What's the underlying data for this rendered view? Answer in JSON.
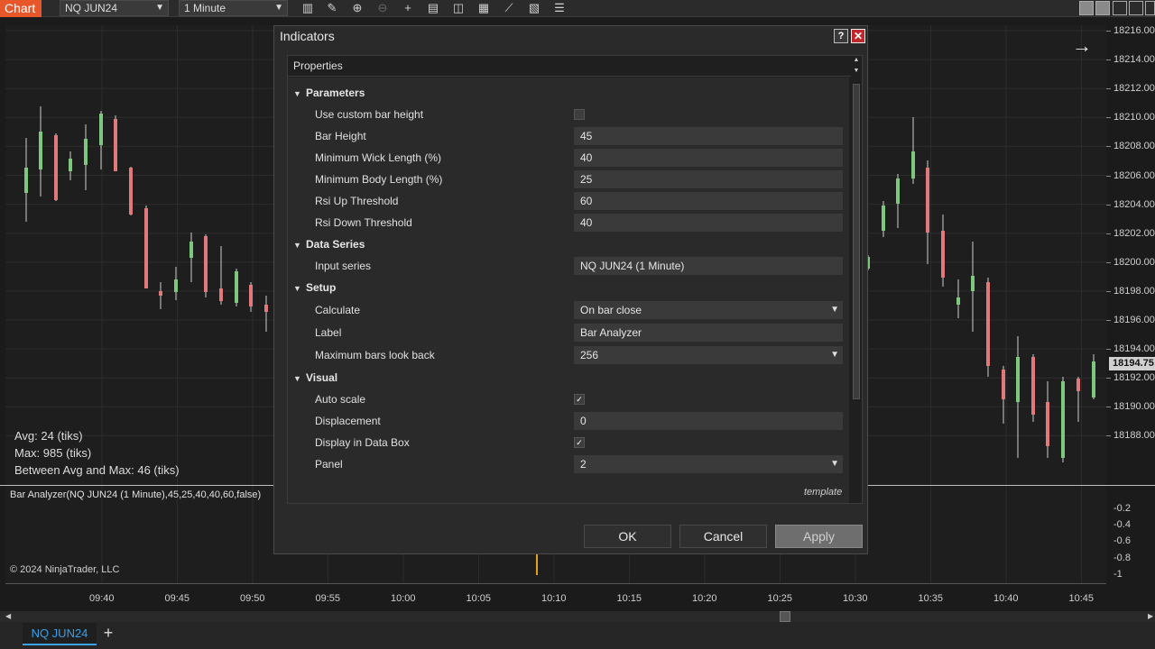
{
  "toolbar": {
    "chart_tab": "Chart",
    "instrument": "NQ JUN24",
    "interval": "1 Minute",
    "icons": [
      "bar-type-icon",
      "draw-pencil-icon",
      "zoom-in-icon",
      "zoom-out-icon",
      "crosshair-icon",
      "data-box-icon",
      "properties-icon",
      "indicators-icon",
      "strategies-icon",
      "templates-icon",
      "menu-icon"
    ]
  },
  "price_axis": {
    "ticks": [
      "18216.00",
      "18214.00",
      "18212.00",
      "18210.00",
      "18208.00",
      "18206.00",
      "18204.00",
      "18202.00",
      "18200.00",
      "18198.00",
      "18196.00",
      "18194.00",
      "18192.00",
      "18190.00",
      "18188.00"
    ],
    "last_price": "18194.75",
    "lower_ticks": [
      "-0.2",
      "-0.4",
      "-0.6",
      "-0.8",
      "-1"
    ]
  },
  "time_axis": [
    "09:40",
    "09:45",
    "09:50",
    "09:55",
    "10:00",
    "10:05",
    "10:10",
    "10:15",
    "10:20",
    "10:25",
    "10:30",
    "10:35",
    "10:40",
    "10:45"
  ],
  "stats": {
    "avg": "Avg: 24 (tiks)",
    "max": "Max: 985 (tiks)",
    "between": "Between Avg and Max: 46 (tiks)"
  },
  "indicator_label": "Bar Analyzer(NQ JUN24 (1 Minute),45,25,40,40,60,false)",
  "copyright": "© 2024 NinjaTrader, LLC",
  "bottom_tabs": {
    "active": "NQ JUN24",
    "add": "+"
  },
  "colors": {
    "up": "#7ec87e",
    "down": "#e07a7a",
    "accent": "#e8572a",
    "tab_blue": "#3aa0e8"
  },
  "dialog": {
    "title": "Indicators",
    "help": "?",
    "close": "✕",
    "grid_header": "Properties",
    "sections": {
      "parameters": "Parameters",
      "data_series": "Data Series",
      "setup": "Setup",
      "visual": "Visual"
    },
    "rows": {
      "use_custom_bar_height": {
        "label": "Use custom bar height",
        "checked": false
      },
      "bar_height": {
        "label": "Bar Height",
        "value": "45"
      },
      "min_wick": {
        "label": "Minimum Wick Length (%)",
        "value": "40"
      },
      "min_body": {
        "label": "Minimum Body Length (%)",
        "value": "25"
      },
      "rsi_up": {
        "label": "Rsi Up Threshold",
        "value": "60"
      },
      "rsi_down": {
        "label": "Rsi Down Threshold",
        "value": "40"
      },
      "input_series": {
        "label": "Input series",
        "value": "NQ JUN24 (1 Minute)"
      },
      "calculate": {
        "label": "Calculate",
        "value": "On bar close"
      },
      "label": {
        "label": "Label",
        "value": "Bar Analyzer"
      },
      "max_bars": {
        "label": "Maximum bars look back",
        "value": "256"
      },
      "auto_scale": {
        "label": "Auto scale",
        "checked": true
      },
      "displacement": {
        "label": "Displacement",
        "value": "0"
      },
      "display_data_box": {
        "label": "Display in Data Box",
        "checked": true
      },
      "panel": {
        "label": "Panel",
        "value": "2"
      }
    },
    "template": "template",
    "ok": "OK",
    "cancel": "Cancel",
    "apply": "Apply"
  }
}
